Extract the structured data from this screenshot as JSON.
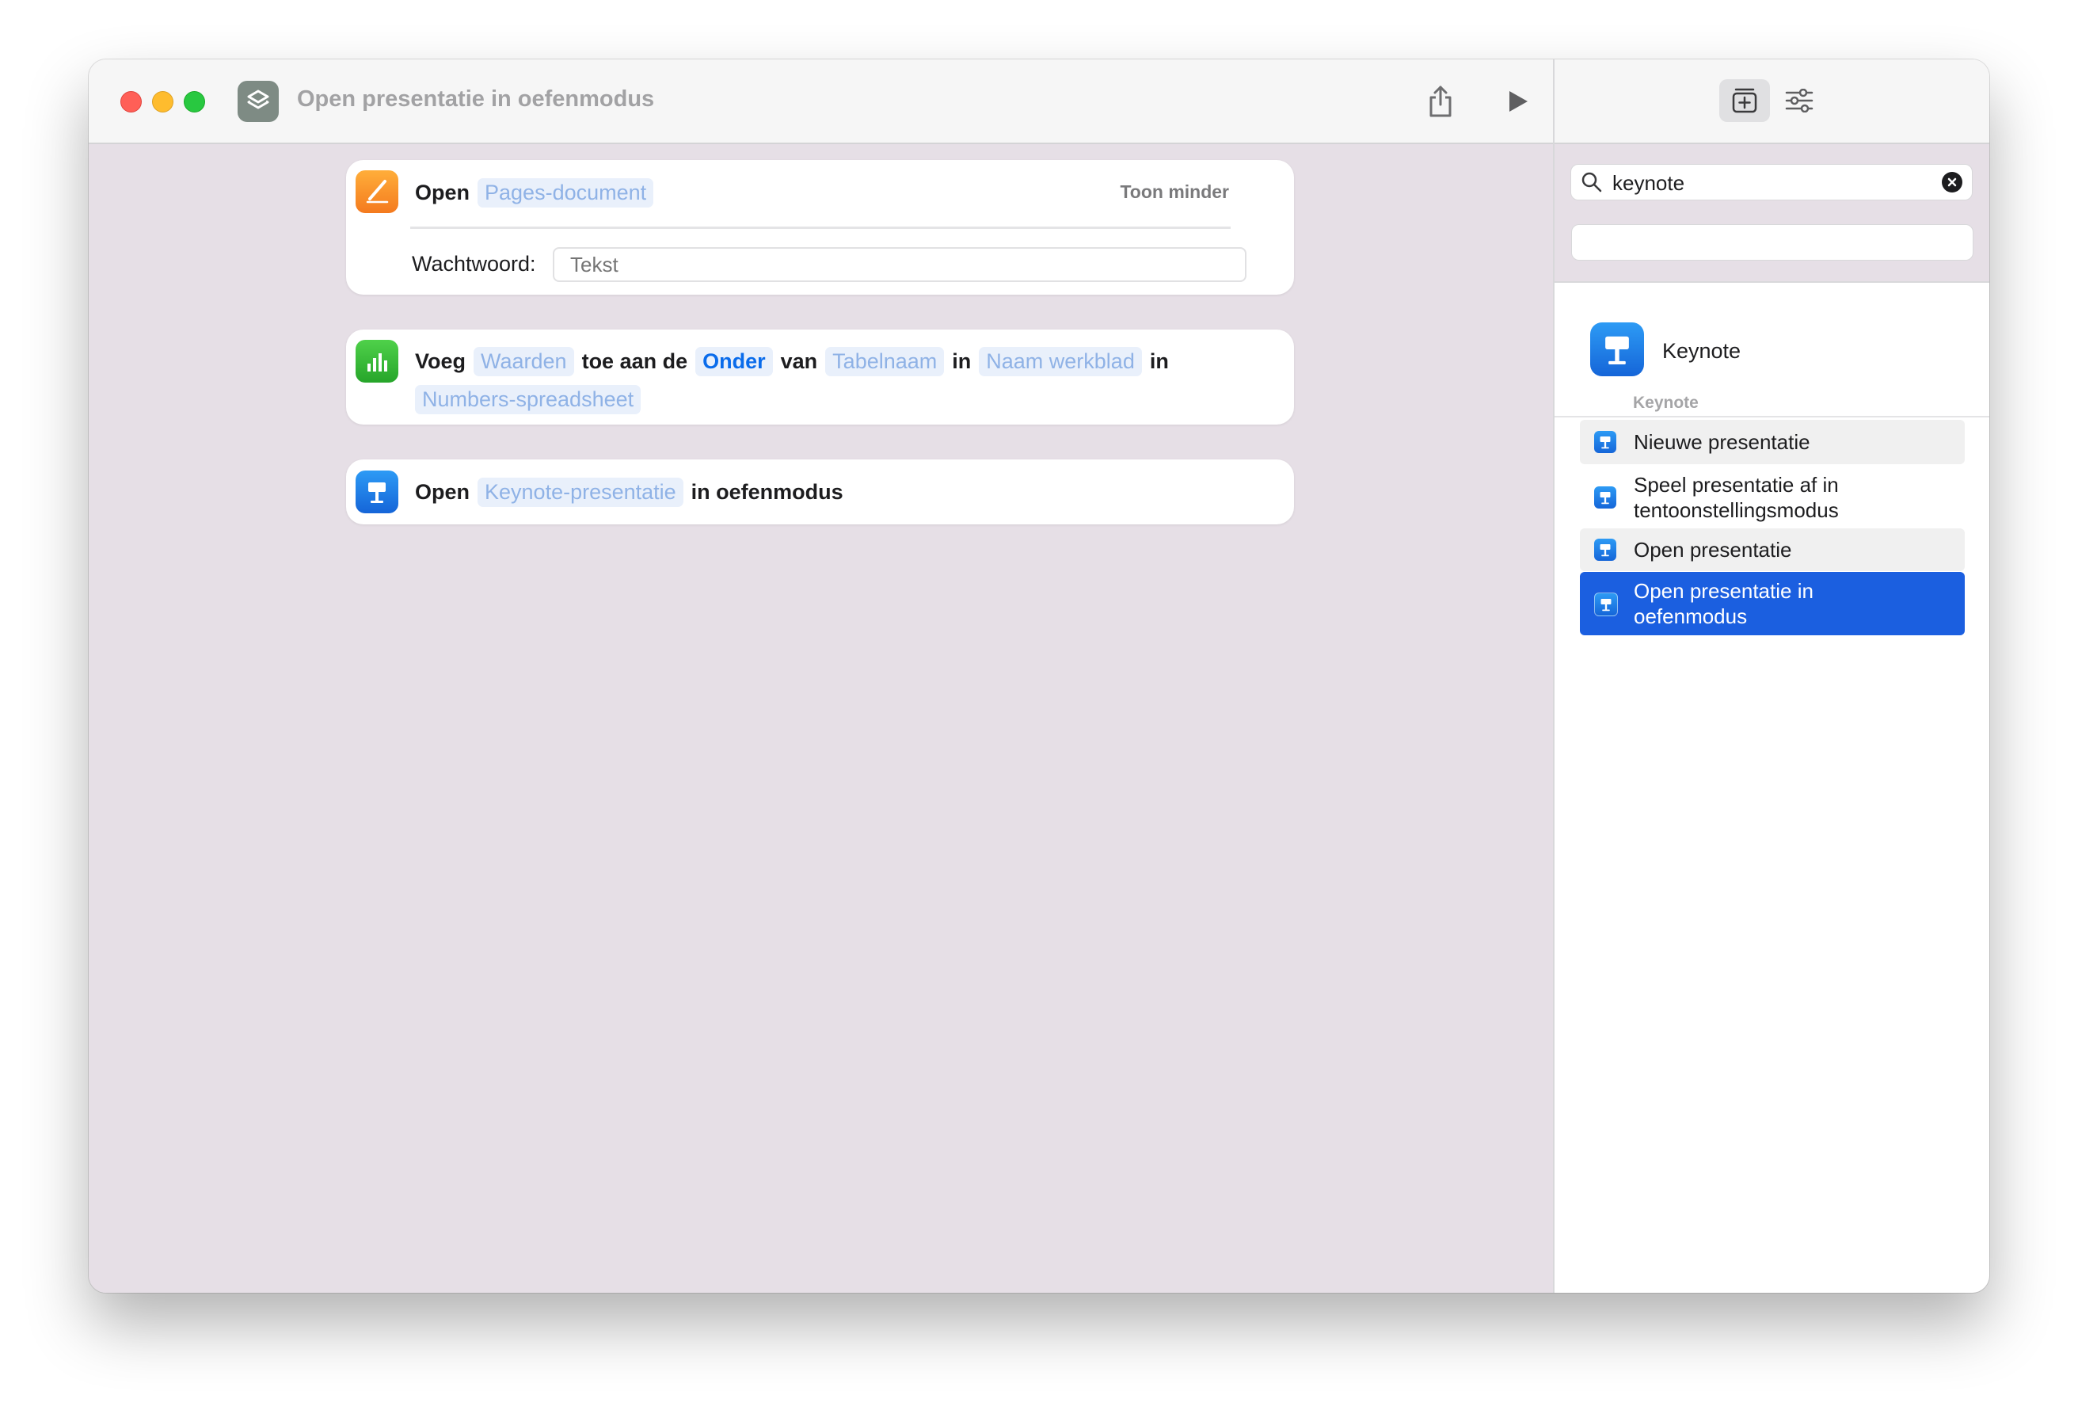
{
  "window": {
    "title": "Open presentatie in oefenmodus"
  },
  "toolbar": {
    "share_icon": "share-icon",
    "run_icon": "play-icon"
  },
  "actions": [
    {
      "app": "Pages",
      "verb": "Open",
      "param": "Pages-document",
      "toggle_label": "Toon minder",
      "password_label": "Wachtwoord:",
      "password_placeholder": "Tekst"
    },
    {
      "app": "Numbers",
      "parts": [
        "Voeg",
        "Waarden",
        "toe aan de",
        "Onder",
        "van",
        "Tabelnaam",
        "in",
        "Naam werkblad",
        "in",
        "Numbers-spreadsheet"
      ]
    },
    {
      "app": "Keynote",
      "verb": "Open",
      "param": "Keynote-presentatie",
      "suffix": "in oefenmodus"
    }
  ],
  "sidebar": {
    "search": {
      "value": "keynote"
    },
    "app_result": "Keynote",
    "section_title": "Keynote",
    "items": [
      {
        "label": "Nieuwe presentatie"
      },
      {
        "label": "Speel presentatie af in tentoonstellingsmodus"
      },
      {
        "label": "Open presentatie"
      },
      {
        "label": "Open presentatie in oefenmodus",
        "selected": true
      }
    ]
  },
  "colors": {
    "accent": "#1b5fe0",
    "token_text": "#8fb2e6",
    "token_bg": "#e9f0fb"
  }
}
